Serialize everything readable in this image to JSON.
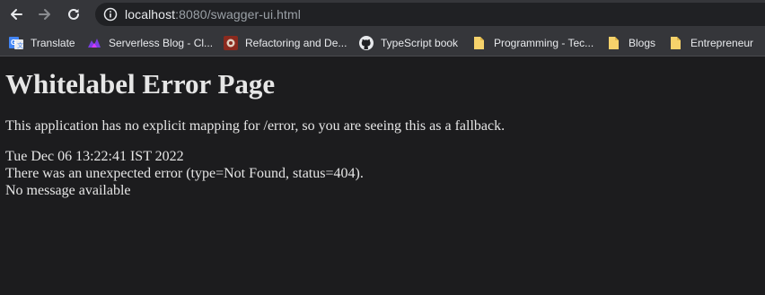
{
  "browser": {
    "url_host": "localhost",
    "url_rest": ":8080/swagger-ui.html",
    "bookmarks": [
      {
        "label": "Translate",
        "icon": "google-translate-icon"
      },
      {
        "label": "Serverless Blog - Cl...",
        "icon": "serverless-icon"
      },
      {
        "label": "Refactoring and De...",
        "icon": "refactoring-icon"
      },
      {
        "label": "TypeScript book",
        "icon": "github-icon"
      },
      {
        "label": "Programming - Tec...",
        "icon": "folder-icon"
      },
      {
        "label": "Blogs",
        "icon": "folder-icon"
      },
      {
        "label": "Entrepreneur",
        "icon": "folder-icon"
      }
    ]
  },
  "page": {
    "title": "Whitelabel Error Page",
    "description": "This application has no explicit mapping for /error, so you are seeing this as a fallback.",
    "timestamp": "Tue Dec 06 13:22:41 IST 2022",
    "error": "There was an unexpected error (type=Not Found, status=404).",
    "message": "No message available"
  }
}
